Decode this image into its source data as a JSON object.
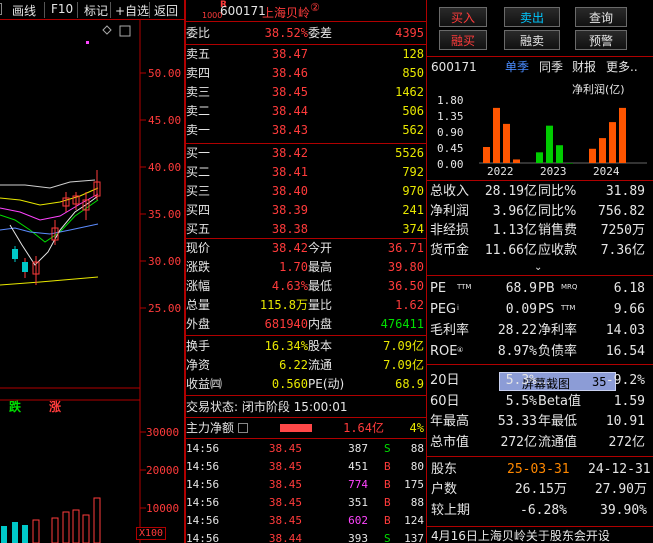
{
  "toolbar": {
    "items": [
      "画线",
      "F10",
      "标记",
      "+自选",
      "返回"
    ]
  },
  "chart": {
    "prices": [
      "50.00",
      "45.00",
      "40.00",
      "35.00",
      "30.00",
      "25.00"
    ],
    "vol_ticks": [
      "30000",
      "20000",
      "10000"
    ],
    "vol_unit": "X100",
    "fall": "跌",
    "rise": "涨"
  },
  "quote": {
    "code": "600171",
    "name": "上海贝岭",
    "badge": "R",
    "badge_sub": "1000",
    "circle": "②",
    "weibi_l": "委比",
    "weibi_v": "38.52%",
    "weicha_l": "委差",
    "weicha_v": "4395",
    "asks": [
      {
        "l": "卖五",
        "p": "38.47",
        "v": "128"
      },
      {
        "l": "卖四",
        "p": "38.46",
        "v": "850"
      },
      {
        "l": "卖三",
        "p": "38.45",
        "v": "1462"
      },
      {
        "l": "卖二",
        "p": "38.44",
        "v": "506"
      },
      {
        "l": "卖一",
        "p": "38.43",
        "v": "562"
      }
    ],
    "bids": [
      {
        "l": "买一",
        "p": "38.42",
        "v": "5526"
      },
      {
        "l": "买二",
        "p": "38.41",
        "v": "792"
      },
      {
        "l": "买三",
        "p": "38.40",
        "v": "970"
      },
      {
        "l": "买四",
        "p": "38.39",
        "v": "241"
      },
      {
        "l": "买五",
        "p": "38.38",
        "v": "374"
      }
    ],
    "stats": [
      {
        "l1": "现价",
        "v1": "38.42",
        "l2": "今开",
        "v2": "36.71",
        "c1": "red",
        "c2": "red"
      },
      {
        "l1": "涨跌",
        "v1": "1.70",
        "l2": "最高",
        "v2": "39.80",
        "c1": "red",
        "c2": "red"
      },
      {
        "l1": "涨幅",
        "v1": "4.63%",
        "l2": "最低",
        "v2": "36.50",
        "c1": "red",
        "c2": "red"
      },
      {
        "l1": "总量",
        "v1": "115.8万",
        "l2": "量比",
        "v2": "1.62",
        "c1": "yel",
        "c2": "red"
      },
      {
        "l1": "外盘",
        "v1": "681940",
        "l2": "内盘",
        "v2": "476411",
        "c1": "red",
        "c2": "grn"
      }
    ],
    "stats2": [
      {
        "l1": "换手",
        "v1": "16.34%",
        "l2": "股本",
        "v2": "7.09亿"
      },
      {
        "l1": "净资",
        "v1": "6.22",
        "l2": "流通",
        "v2": "7.09亿"
      },
      {
        "l1": "收益㈣",
        "v1": "0.560",
        "l2": "PE(动)",
        "v2": "68.9"
      }
    ],
    "trade_status": "交易状态: 闭市阶段 15:00:01",
    "main_flow_l": "主力净额",
    "main_flow_v": "1.64亿",
    "main_flow_p": "4%",
    "ticks": [
      {
        "t": "14:56",
        "p": "38.45",
        "v": "387",
        "s": "S",
        "n": "88",
        "vc": "wht"
      },
      {
        "t": "14:56",
        "p": "38.45",
        "v": "451",
        "s": "B",
        "n": "80",
        "vc": "wht"
      },
      {
        "t": "14:56",
        "p": "38.45",
        "v": "774",
        "s": "B",
        "n": "175",
        "vc": "mag"
      },
      {
        "t": "14:56",
        "p": "38.45",
        "v": "351",
        "s": "B",
        "n": "88",
        "vc": "wht"
      },
      {
        "t": "14:56",
        "p": "38.45",
        "v": "602",
        "s": "B",
        "n": "124",
        "vc": "mag"
      },
      {
        "t": "14:56",
        "p": "38.44",
        "v": "393",
        "s": "S",
        "n": "137",
        "vc": "wht"
      }
    ]
  },
  "panel": {
    "buttons": [
      "买入",
      "卖出",
      "查询",
      "融买",
      "融卖",
      "预警"
    ],
    "tabs": {
      "code": "600171",
      "t1": "单季",
      "t2": "同季",
      "t3": "财报",
      "t4": "更多.."
    },
    "fin_chart": {
      "ylabel": "净利润(亿)",
      "yticks": [
        "1.80",
        "1.35",
        "0.90",
        "0.45",
        "0.00"
      ],
      "years": [
        "2022",
        "2023",
        "2024"
      ]
    },
    "fin_rows": [
      {
        "l1": "总收入",
        "v1": "28.19亿",
        "l2": "同比%",
        "v2": "31.89"
      },
      {
        "l1": "净利润",
        "v1": "3.96亿",
        "l2": "同比%",
        "v2": "756.82"
      },
      {
        "l1": "非经损",
        "v1": "1.13亿",
        "l2": "销售费",
        "v2": "7250万"
      },
      {
        "l1": "货币金",
        "v1": "11.66亿",
        "l2": "应收款",
        "v2": "7.36亿"
      }
    ],
    "val_rows": [
      {
        "l1": "PE",
        "s1": "TTM",
        "v1": "68.9",
        "l2": "PB",
        "s2": "MRQ",
        "v2": "6.18"
      },
      {
        "l1": "PEG",
        "s1": "i",
        "v1": "0.09",
        "l2": "PS",
        "s2": "TTM",
        "v2": "9.66"
      },
      {
        "l1": "毛利率",
        "s1": "",
        "v1": "28.22",
        "l2": "净利率",
        "s2": "",
        "v2": "14.03"
      },
      {
        "l1": "ROE",
        "s1": "④",
        "v1": "8.97%",
        "l2": "负债率",
        "s2": "",
        "v2": "16.54"
      }
    ],
    "perf": [
      {
        "l1": "20日",
        "v1": "5.3%",
        "l2": "...",
        "v2": "-9.2%",
        "hidden": true
      },
      {
        "l1": "60日",
        "v1": "5.5%",
        "l2": "Beta值",
        "v2": "1.59"
      },
      {
        "l1": "年最高",
        "v1": "53.33",
        "l2": "年最低",
        "v2": "10.91"
      },
      {
        "l1": "总市值",
        "v1": "272亿",
        "l2": "流通值",
        "v2": "272亿"
      }
    ],
    "screenshot_label": "屏幕截图",
    "screenshot_num": "35",
    "holders": {
      "l": "股东",
      "d1": "25-03-31",
      "d2": "24-12-31",
      "rows": [
        {
          "l": "户数",
          "v1": "26.15万",
          "v2": "27.90万"
        },
        {
          "l": "较上期",
          "v1": "-6.28%",
          "v2": "39.90%"
        }
      ]
    },
    "news": "4月16日上海贝岭关于股东会开设"
  },
  "colors": {
    "up": "#ff3b3b",
    "down": "#00e000",
    "border": "#b00000",
    "accent": "#e8e800"
  }
}
